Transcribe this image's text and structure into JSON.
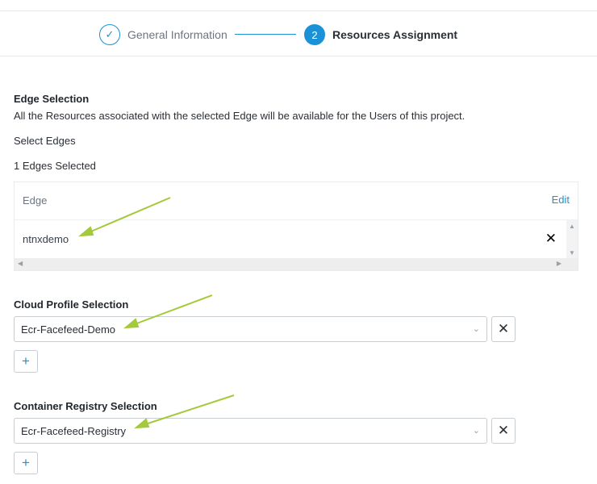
{
  "stepper": {
    "step1": {
      "icon": "✓",
      "label": "General Information"
    },
    "step2": {
      "number": "2",
      "label": "Resources Assignment"
    }
  },
  "edge_selection": {
    "title": "Edge Selection",
    "description": "All the Resources associated with the selected Edge will be available for the Users of this project.",
    "select_label": "Select Edges",
    "selected_count": "1 Edges Selected",
    "table": {
      "column_header": "Edge",
      "edit_label": "Edit",
      "rows": [
        {
          "name": "ntnxdemo",
          "remove_icon": "✕"
        }
      ]
    }
  },
  "cloud_profile": {
    "title": "Cloud Profile Selection",
    "selected_value": "Ecr-Facefeed-Demo",
    "remove_icon": "✕",
    "add_icon": "+"
  },
  "container_registry": {
    "title": "Container Registry Selection",
    "selected_value": "Ecr-Facefeed-Registry",
    "remove_icon": "✕",
    "add_icon": "+"
  },
  "colors": {
    "accent": "#1b92d8",
    "annotation_arrow": "#a4c93a",
    "border": "#c8cdd2"
  }
}
